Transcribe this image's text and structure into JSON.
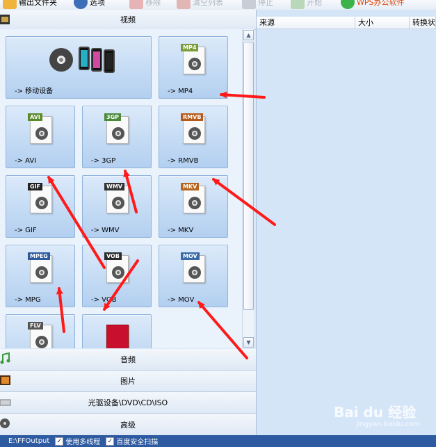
{
  "toolbar": {
    "output_folder": "输出文件夹",
    "options": "选项",
    "remove": "移除",
    "clear_list": "清空列表",
    "stop": "停止",
    "start": "开始",
    "wps": "WPS办公软件"
  },
  "left": {
    "video_header": "视频",
    "audio_header": "音频",
    "image_header": "图片",
    "disc_header": "光驱设备\\DVD\\CD\\ISO",
    "advanced_header": "高级",
    "tiles": [
      {
        "label": "-> 移动设备",
        "badge": ""
      },
      {
        "label": "-> MP4",
        "badge": "MP4"
      },
      {
        "label": "-> AVI",
        "badge": "AVI"
      },
      {
        "label": "-> 3GP",
        "badge": "3GP"
      },
      {
        "label": "-> RMVB",
        "badge": "RMVB"
      },
      {
        "label": "-> GIF",
        "badge": "GIF"
      },
      {
        "label": "-> WMV",
        "badge": "WMV"
      },
      {
        "label": "-> MKV",
        "badge": "MKV"
      },
      {
        "label": "-> MPG",
        "badge": "MPEG"
      },
      {
        "label": "-> VOB",
        "badge": "VOB"
      },
      {
        "label": "-> MOV",
        "badge": "MOV"
      },
      {
        "label": "",
        "badge": "FLV"
      },
      {
        "label": "",
        "badge": ""
      }
    ]
  },
  "right": {
    "col_source": "来源",
    "col_size": "大小",
    "col_status": "转换状态"
  },
  "status": {
    "path": "E:\\FFOutput",
    "multithread": "使用多线程",
    "safe_scan": "百度安全扫描"
  },
  "watermark": {
    "logo": "Bai du 经验",
    "url": "jingyan.baidu.com"
  },
  "colors": {
    "arrow": "#ff1a1a",
    "status_bar": "#2d5aa0"
  }
}
